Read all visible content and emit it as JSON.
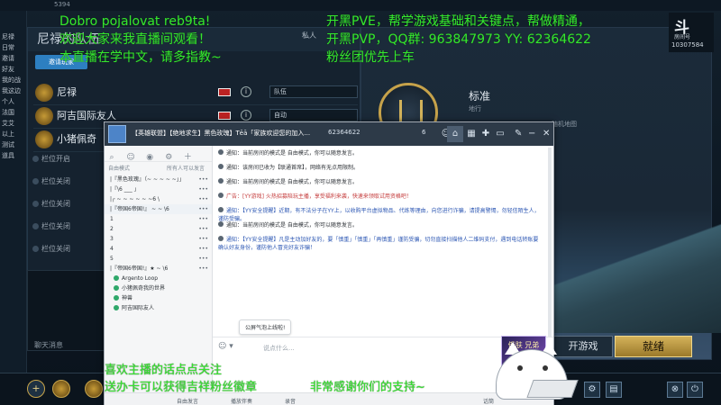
{
  "lobby": {
    "top_left": "5394",
    "left_col": [
      "尼禄",
      "日常",
      "邀请",
      "好友",
      "我的战",
      "我这边",
      "个人",
      "法国",
      "艾艾",
      "以上",
      "测试",
      "道具"
    ],
    "team_title": "尼禄的队伍",
    "invite_btn": "邀请玩家",
    "players": [
      {
        "name": "尼禄",
        "mode": "队伍"
      },
      {
        "name": "阿吉国际友人",
        "mode": "自动"
      },
      {
        "name": "小猪佩奇",
        "mode": ""
      }
    ],
    "slots": [
      "栏位开启",
      "栏位关闭",
      "栏位关闭",
      "栏位关闭",
      "栏位关闭"
    ],
    "chat_title": "聊天消息",
    "mode_name": "标准",
    "mode_sub": "地行",
    "map_sub": "随机地图",
    "start_btn": "开游戏",
    "ready_btn": "就绪",
    "logo_mark": "斗",
    "logo_text": "房间号",
    "room_id": "10307584",
    "private_label": "私人"
  },
  "qq": {
    "title": "【英雄联盟】【绝地求生】黑色玫瑰】Tēā「家族欢迎您的加入...",
    "group_id": "62364622",
    "members": "6",
    "filter_label": "自由模式",
    "filter_right": "所有人可以发言",
    "groups": [
      "|『黑色玫瑰』（~ ~ ~ ~ ~」」",
      "|『\\6 ___ 」",
      "|┌ ~ ~ ~ ~ ~ ~6 \\",
      "|『帝国6帝国!』 ~ ~ \\6",
      "1",
      "2",
      "3",
      "4",
      "5",
      "|『帝国6帝国!』★ ~ \\6"
    ],
    "users": [
      "Argento Loop",
      "小猪佩奇我的世界",
      "神兽",
      "阿吉国际友人"
    ],
    "notices": [
      {
        "text": "通知：当前房间的模式是 自由模式，你可以随意发言。",
        "tone": "normal"
      },
      {
        "text": "通知：该房间已收为【联通首席】，网络有无点用限制。",
        "tone": "normal"
      },
      {
        "text": "通知：当前房间的模式是 自由模式，你可以随意发言。",
        "tone": "normal"
      },
      {
        "text": "广告：[YY游戏] 火热招募陪玩主播，享受福利来袭，快速来领取试用资格吧！",
        "tone": "red"
      },
      {
        "text": "通知：【YY安全提醒】近期，有不法分子在YY上，以收购平台虚拟物品、代练等理由，向您进行诈骗，请提高警惕，勿轻信陌生人，谨防受骗。",
        "tone": "blue"
      },
      {
        "text": "通知：当前房间的模式是 自由模式，你可以随意发言。",
        "tone": "normal"
      },
      {
        "text": "通知：【YY安全提醒】凡是主动加好友的，要「慎重」「慎重」「再慎重」谨防受骗，切勿直接扫描他人二维码支付，遇到电话转账要确认好友身份，谨防他人冒充好友诈骗！",
        "tone": "blue"
      }
    ],
    "bubble": "公屏气泡上线啦!",
    "input_placeholder": "说点什么...",
    "footer": [
      "自由发言",
      "播放伴奏",
      "录音",
      "话筒"
    ]
  },
  "overlays": {
    "welcome": "Dobro pojalovat reb9ta!",
    "welcome2": "欢迎大家来我直播间观看！",
    "study": "本直播在学中文，请多指教~",
    "pve": "开黑PVE，帮学游戏基础和关键点，帮做精通，",
    "pvp": "开黑PVP，QQ群: 963847973 YY: 62364622",
    "fans": "粉丝团优先上车",
    "follow": "喜欢主播的话点点关注",
    "gift": "送办卡可以获得吉祥粉丝徽章",
    "thanks": "非常感谢你们的支持~",
    "poster": "俄肤 兄弟"
  },
  "colors": {
    "overlay": "#35e62f",
    "gold": "#d4b25a",
    "qq_title": "#2d3a48"
  }
}
